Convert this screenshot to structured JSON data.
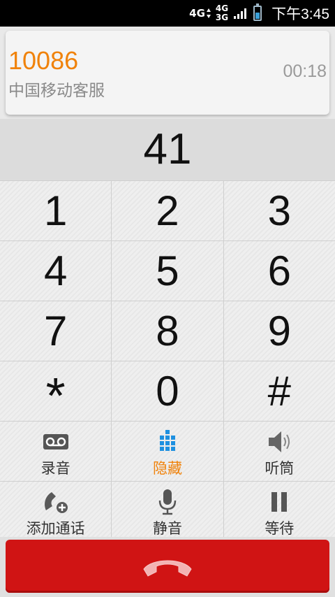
{
  "status_bar": {
    "network_primary": "4G",
    "network_top": "4G",
    "network_bottom": "3G",
    "time": "下午3:45",
    "battery_level": 0.5,
    "icons": [
      "data-arrows-icon",
      "signal-icon",
      "battery-icon"
    ]
  },
  "call": {
    "number": "10086",
    "name": "中国移动客服",
    "duration": "00:18"
  },
  "dialpad": {
    "entered": "41",
    "keys": [
      "1",
      "2",
      "3",
      "4",
      "5",
      "6",
      "7",
      "8",
      "9",
      "*",
      "0",
      "#"
    ]
  },
  "actions": {
    "record_label": "录音",
    "hide_label": "隐藏",
    "speaker_label": "听筒",
    "add_call_label": "添加通话",
    "mute_label": "静音",
    "hold_label": "等待",
    "active_color": "#f0820a"
  },
  "end_call": {
    "icon": "hang-up-icon",
    "color": "#d01414"
  }
}
